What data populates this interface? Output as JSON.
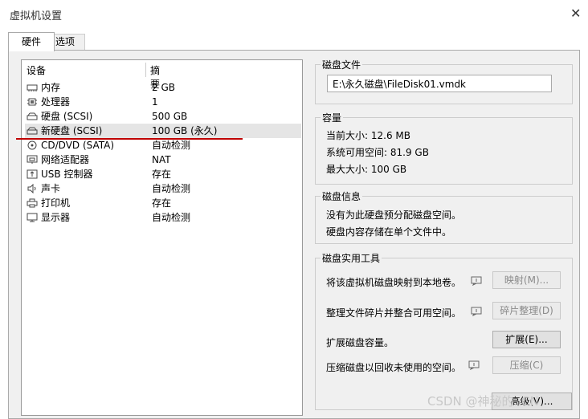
{
  "window": {
    "title": "虚拟机设置",
    "close_icon": "close-icon"
  },
  "tabs": [
    {
      "label": "硬件",
      "active": true
    },
    {
      "label": "选项",
      "active": false
    }
  ],
  "device_list": {
    "col_device": "设备",
    "col_summary": "摘要",
    "items": [
      {
        "name": "内存",
        "summary": "2 GB",
        "icon": "memory-icon"
      },
      {
        "name": "处理器",
        "summary": "1",
        "icon": "cpu-icon"
      },
      {
        "name": "硬盘 (SCSI)",
        "summary": "500 GB",
        "icon": "harddisk-icon"
      },
      {
        "name": "新硬盘 (SCSI)",
        "summary": "100 GB (永久)",
        "icon": "harddisk-icon",
        "selected": true
      },
      {
        "name": "CD/DVD (SATA)",
        "summary": "自动检测",
        "icon": "cd-icon"
      },
      {
        "name": "网络适配器",
        "summary": "NAT",
        "icon": "network-icon"
      },
      {
        "name": "USB 控制器",
        "summary": "存在",
        "icon": "usb-icon"
      },
      {
        "name": "声卡",
        "summary": "自动检测",
        "icon": "speaker-icon"
      },
      {
        "name": "打印机",
        "summary": "存在",
        "icon": "printer-icon"
      },
      {
        "name": "显示器",
        "summary": "自动检测",
        "icon": "monitor-icon"
      }
    ]
  },
  "disk_file": {
    "title": "磁盘文件",
    "path": "E:\\永久磁盘\\FileDisk01.vmdk"
  },
  "capacity": {
    "title": "容量",
    "current_size": "当前大小: 12.6 MB",
    "available": "系统可用空间: 81.9 GB",
    "max_size": "最大大小: 100 GB"
  },
  "disk_info": {
    "title": "磁盘信息",
    "line1": "没有为此硬盘预分配磁盘空间。",
    "line2": "硬盘内容存储在单个文件中。"
  },
  "utilities": {
    "title": "磁盘实用工具",
    "rows": [
      {
        "text": "将该虚拟机磁盘映射到本地卷。",
        "button": "映射(M)...",
        "enabled": false
      },
      {
        "text": "整理文件碎片并整合可用空间。",
        "button": "碎片整理(D)",
        "enabled": false
      },
      {
        "text": "扩展磁盘容量。",
        "button": "扩展(E)...",
        "enabled": true
      },
      {
        "text": "压缩磁盘以回收未使用的空间。",
        "button": "压缩(C)",
        "enabled": false
      }
    ]
  },
  "advanced_button": "高级(V)...",
  "watermark": "CSDN @神秘的..CN"
}
